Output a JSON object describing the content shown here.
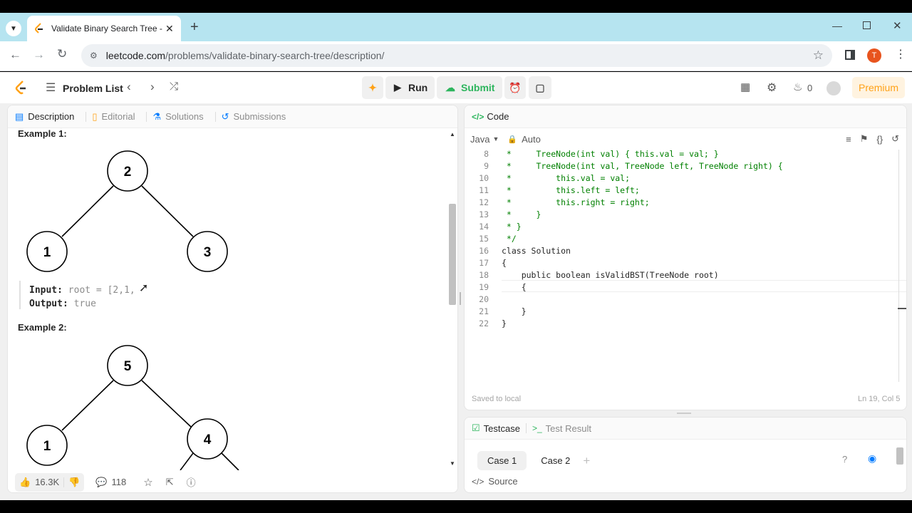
{
  "browser": {
    "tab_title": "Validate Binary Search Tree - Le",
    "url_host": "leetcode.com",
    "url_path": "/problems/validate-binary-search-tree/description/",
    "profile_initial": "T"
  },
  "nav": {
    "problem_list": "Problem List",
    "run": "Run",
    "submit": "Submit",
    "fire_count": "0",
    "premium": "Premium"
  },
  "left": {
    "tabs": [
      "Description",
      "Editorial",
      "Solutions",
      "Submissions"
    ],
    "example1": {
      "title": "Example 1:",
      "nodes": [
        "2",
        "1",
        "3"
      ],
      "input_label": "Input:",
      "input_value": "root = [2,1,",
      "output_label": "Output:",
      "output_value": "true"
    },
    "example2": {
      "title": "Example 2:",
      "nodes": [
        "5",
        "1",
        "4"
      ]
    },
    "footer": {
      "likes": "16.3K",
      "comments": "118"
    }
  },
  "code": {
    "title": "Code",
    "language": "Java",
    "auto": "Auto",
    "lines": [
      {
        "n": "8",
        "text": " *     TreeNode(int val) { this.val = val; }"
      },
      {
        "n": "9",
        "text": " *     TreeNode(int val, TreeNode left, TreeNode right) {"
      },
      {
        "n": "10",
        "text": " *         this.val = val;"
      },
      {
        "n": "11",
        "text": " *         this.left = left;"
      },
      {
        "n": "12",
        "text": " *         this.right = right;"
      },
      {
        "n": "13",
        "text": " *     }"
      },
      {
        "n": "14",
        "text": " * }"
      },
      {
        "n": "15",
        "text": " */"
      },
      {
        "n": "16",
        "text": "class Solution"
      },
      {
        "n": "17",
        "text": "{"
      },
      {
        "n": "18",
        "text": "    public boolean isValidBST(TreeNode root)"
      },
      {
        "n": "19",
        "text": "    {"
      },
      {
        "n": "20",
        "text": ""
      },
      {
        "n": "21",
        "text": "    }"
      },
      {
        "n": "22",
        "text": "}"
      }
    ],
    "saved": "Saved to local",
    "cursor_pos": "Ln 19, Col 5"
  },
  "testcase": {
    "tab_testcase": "Testcase",
    "tab_result": "Test Result",
    "cases": [
      "Case 1",
      "Case 2"
    ],
    "source": "Source"
  },
  "colors": {
    "accent": "#2db55d",
    "premium": "#ffa116",
    "tab_bar": "#b6e4f0"
  }
}
